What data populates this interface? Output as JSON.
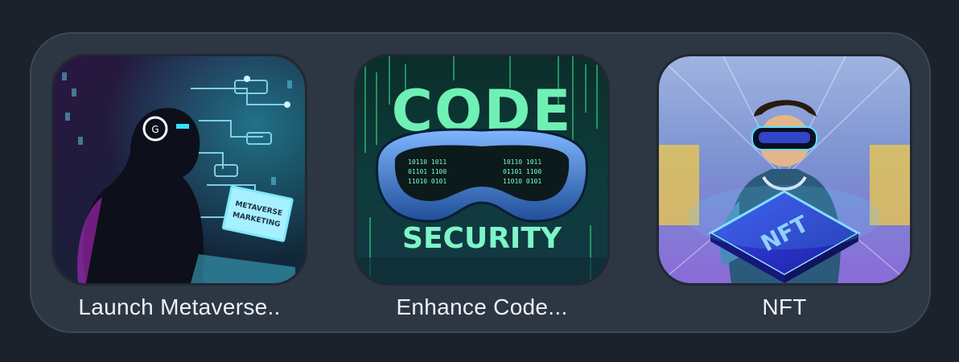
{
  "apps": [
    {
      "label": "Launch Metaverse..",
      "image_text": [
        "METAVERSE",
        "MARKETING"
      ],
      "icon": "metaverse-marketing-thumbnail"
    },
    {
      "label": "Enhance Code...",
      "image_text": [
        "CODE",
        "SECURITY"
      ],
      "icon": "code-security-thumbnail"
    },
    {
      "label": "NFT",
      "image_text": [
        "NFT"
      ],
      "icon": "nft-thumbnail"
    }
  ],
  "colors": {
    "background": "#1c222c",
    "panel": "#2d3643",
    "label": "#eef1f6"
  }
}
